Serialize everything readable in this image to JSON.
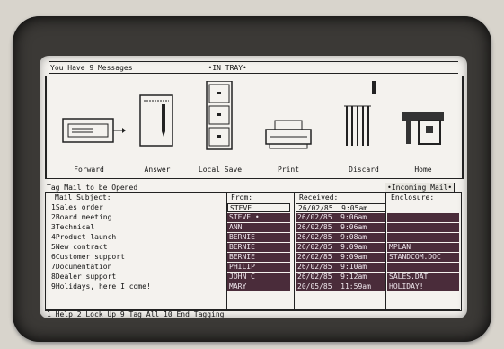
{
  "header": {
    "message_count": "You Have 9 Messages",
    "tray": "•IN TRAY•"
  },
  "tools": [
    {
      "label": "Forward",
      "icon": "forward-tray-icon"
    },
    {
      "label": "Answer",
      "icon": "answer-notepad-icon"
    },
    {
      "label": "Local Save",
      "icon": "filing-cabinet-icon"
    },
    {
      "label": "Print",
      "icon": "printer-icon"
    },
    {
      "label": "Discard",
      "icon": "shredder-icon"
    },
    {
      "label": "Home",
      "icon": "house-icon"
    }
  ],
  "tag_line": "Tag Mail to be Opened",
  "incoming_label": "•Incoming Mail•",
  "columns": {
    "subject": "Mail Subject:",
    "from": "From:",
    "received": "Received:",
    "enclosure": "Enclosure:"
  },
  "messages": [
    {
      "subject": "1Sales order",
      "from": "STEVE",
      "date": "26/02/85",
      "time": "9:05am",
      "enclosure": ""
    },
    {
      "subject": "2Board meeting",
      "from": "STEVE •",
      "date": "26/02/85",
      "time": "9:06am",
      "enclosure": ""
    },
    {
      "subject": "3Technical",
      "from": "ANN",
      "date": "26/02/85",
      "time": "9:06am",
      "enclosure": ""
    },
    {
      "subject": "4Product launch",
      "from": "BERNIE",
      "date": "26/02/85",
      "time": "9:08am",
      "enclosure": ""
    },
    {
      "subject": "5New contract",
      "from": "BERNIE",
      "date": "26/02/85",
      "time": "9:09am",
      "enclosure": "MPLAN"
    },
    {
      "subject": "6Customer support",
      "from": "BERNIE",
      "date": "26/02/85",
      "time": "9:09am",
      "enclosure": "STANDCOM.DOC"
    },
    {
      "subject": "7Documentation",
      "from": "PHILIP",
      "date": "26/02/85",
      "time": "9:10am",
      "enclosure": ""
    },
    {
      "subject": "8Dealer support",
      "from": "JOHN C",
      "date": "26/02/85",
      "time": "9:12am",
      "enclosure": "SALES.DAT"
    },
    {
      "subject": "9Holidays, here I come!",
      "from": "MARY",
      "date": "20/05/85",
      "time": "11:59am",
      "enclosure": "HOLIDAY!"
    }
  ],
  "footer": "1 Help  2 Lock Up  9 Tag All  10 End Tagging"
}
